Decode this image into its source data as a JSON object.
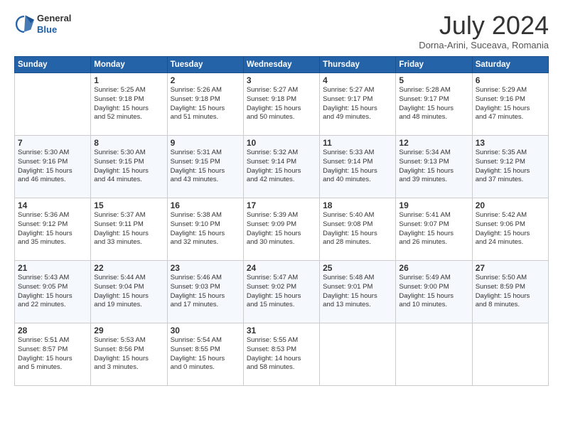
{
  "logo": {
    "general": "General",
    "blue": "Blue"
  },
  "title": "July 2024",
  "location": "Dorna-Arini, Suceava, Romania",
  "weekdays": [
    "Sunday",
    "Monday",
    "Tuesday",
    "Wednesday",
    "Thursday",
    "Friday",
    "Saturday"
  ],
  "weeks": [
    [
      {
        "day": "",
        "info": ""
      },
      {
        "day": "1",
        "info": "Sunrise: 5:25 AM\nSunset: 9:18 PM\nDaylight: 15 hours\nand 52 minutes."
      },
      {
        "day": "2",
        "info": "Sunrise: 5:26 AM\nSunset: 9:18 PM\nDaylight: 15 hours\nand 51 minutes."
      },
      {
        "day": "3",
        "info": "Sunrise: 5:27 AM\nSunset: 9:18 PM\nDaylight: 15 hours\nand 50 minutes."
      },
      {
        "day": "4",
        "info": "Sunrise: 5:27 AM\nSunset: 9:17 PM\nDaylight: 15 hours\nand 49 minutes."
      },
      {
        "day": "5",
        "info": "Sunrise: 5:28 AM\nSunset: 9:17 PM\nDaylight: 15 hours\nand 48 minutes."
      },
      {
        "day": "6",
        "info": "Sunrise: 5:29 AM\nSunset: 9:16 PM\nDaylight: 15 hours\nand 47 minutes."
      }
    ],
    [
      {
        "day": "7",
        "info": "Sunrise: 5:30 AM\nSunset: 9:16 PM\nDaylight: 15 hours\nand 46 minutes."
      },
      {
        "day": "8",
        "info": "Sunrise: 5:30 AM\nSunset: 9:15 PM\nDaylight: 15 hours\nand 44 minutes."
      },
      {
        "day": "9",
        "info": "Sunrise: 5:31 AM\nSunset: 9:15 PM\nDaylight: 15 hours\nand 43 minutes."
      },
      {
        "day": "10",
        "info": "Sunrise: 5:32 AM\nSunset: 9:14 PM\nDaylight: 15 hours\nand 42 minutes."
      },
      {
        "day": "11",
        "info": "Sunrise: 5:33 AM\nSunset: 9:14 PM\nDaylight: 15 hours\nand 40 minutes."
      },
      {
        "day": "12",
        "info": "Sunrise: 5:34 AM\nSunset: 9:13 PM\nDaylight: 15 hours\nand 39 minutes."
      },
      {
        "day": "13",
        "info": "Sunrise: 5:35 AM\nSunset: 9:12 PM\nDaylight: 15 hours\nand 37 minutes."
      }
    ],
    [
      {
        "day": "14",
        "info": "Sunrise: 5:36 AM\nSunset: 9:12 PM\nDaylight: 15 hours\nand 35 minutes."
      },
      {
        "day": "15",
        "info": "Sunrise: 5:37 AM\nSunset: 9:11 PM\nDaylight: 15 hours\nand 33 minutes."
      },
      {
        "day": "16",
        "info": "Sunrise: 5:38 AM\nSunset: 9:10 PM\nDaylight: 15 hours\nand 32 minutes."
      },
      {
        "day": "17",
        "info": "Sunrise: 5:39 AM\nSunset: 9:09 PM\nDaylight: 15 hours\nand 30 minutes."
      },
      {
        "day": "18",
        "info": "Sunrise: 5:40 AM\nSunset: 9:08 PM\nDaylight: 15 hours\nand 28 minutes."
      },
      {
        "day": "19",
        "info": "Sunrise: 5:41 AM\nSunset: 9:07 PM\nDaylight: 15 hours\nand 26 minutes."
      },
      {
        "day": "20",
        "info": "Sunrise: 5:42 AM\nSunset: 9:06 PM\nDaylight: 15 hours\nand 24 minutes."
      }
    ],
    [
      {
        "day": "21",
        "info": "Sunrise: 5:43 AM\nSunset: 9:05 PM\nDaylight: 15 hours\nand 22 minutes."
      },
      {
        "day": "22",
        "info": "Sunrise: 5:44 AM\nSunset: 9:04 PM\nDaylight: 15 hours\nand 19 minutes."
      },
      {
        "day": "23",
        "info": "Sunrise: 5:46 AM\nSunset: 9:03 PM\nDaylight: 15 hours\nand 17 minutes."
      },
      {
        "day": "24",
        "info": "Sunrise: 5:47 AM\nSunset: 9:02 PM\nDaylight: 15 hours\nand 15 minutes."
      },
      {
        "day": "25",
        "info": "Sunrise: 5:48 AM\nSunset: 9:01 PM\nDaylight: 15 hours\nand 13 minutes."
      },
      {
        "day": "26",
        "info": "Sunrise: 5:49 AM\nSunset: 9:00 PM\nDaylight: 15 hours\nand 10 minutes."
      },
      {
        "day": "27",
        "info": "Sunrise: 5:50 AM\nSunset: 8:59 PM\nDaylight: 15 hours\nand 8 minutes."
      }
    ],
    [
      {
        "day": "28",
        "info": "Sunrise: 5:51 AM\nSunset: 8:57 PM\nDaylight: 15 hours\nand 5 minutes."
      },
      {
        "day": "29",
        "info": "Sunrise: 5:53 AM\nSunset: 8:56 PM\nDaylight: 15 hours\nand 3 minutes."
      },
      {
        "day": "30",
        "info": "Sunrise: 5:54 AM\nSunset: 8:55 PM\nDaylight: 15 hours\nand 0 minutes."
      },
      {
        "day": "31",
        "info": "Sunrise: 5:55 AM\nSunset: 8:53 PM\nDaylight: 14 hours\nand 58 minutes."
      },
      {
        "day": "",
        "info": ""
      },
      {
        "day": "",
        "info": ""
      },
      {
        "day": "",
        "info": ""
      }
    ]
  ]
}
